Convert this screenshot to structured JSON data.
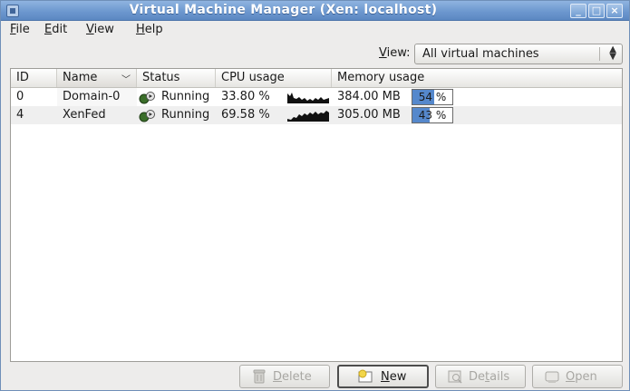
{
  "window": {
    "title": "Virtual Machine Manager (Xen: localhost)",
    "controls": [
      "minimize",
      "maximize",
      "close"
    ]
  },
  "menu": [
    {
      "mnemonic": "F",
      "rest": "ile"
    },
    {
      "mnemonic": "E",
      "rest": "dit"
    },
    {
      "mnemonic": "V",
      "rest": "iew"
    },
    {
      "mnemonic": "H",
      "rest": "elp"
    }
  ],
  "view_filter": {
    "label_mnemonic": "V",
    "label_rest": "iew:",
    "selected": "All virtual machines"
  },
  "table": {
    "columns": [
      "ID",
      "Name",
      "Status",
      "CPU usage",
      "Memory usage"
    ],
    "sorted_column": "Name",
    "rows": [
      {
        "id": "0",
        "name": "Domain-0",
        "status": "Running",
        "cpu": "33.80 %",
        "memory": "384.00 MB",
        "mem_percent_label": "54 %",
        "mem_percent": 54
      },
      {
        "id": "4",
        "name": "XenFed",
        "status": "Running",
        "cpu": "69.58 %",
        "memory": "305.00 MB",
        "mem_percent_label": "43 %",
        "mem_percent": 43
      }
    ]
  },
  "buttons": [
    {
      "key": "delete",
      "mnemonic": "D",
      "rest": "elete",
      "enabled": false,
      "icon": "trash-icon"
    },
    {
      "key": "new",
      "mnemonic": "N",
      "rest": "ew",
      "enabled": true,
      "icon": "new-vm-icon"
    },
    {
      "key": "details",
      "mnemonic": "",
      "pre": "De",
      "mnemonic2": "t",
      "rest": "ails",
      "enabled": false,
      "icon": "details-icon"
    },
    {
      "key": "open",
      "mnemonic": "O",
      "rest": "pen",
      "enabled": false,
      "icon": "open-icon"
    }
  ],
  "colors": {
    "titlebar": "#6d98cf",
    "mem_fill": "#5588cc",
    "alt_row": "#efefef"
  }
}
